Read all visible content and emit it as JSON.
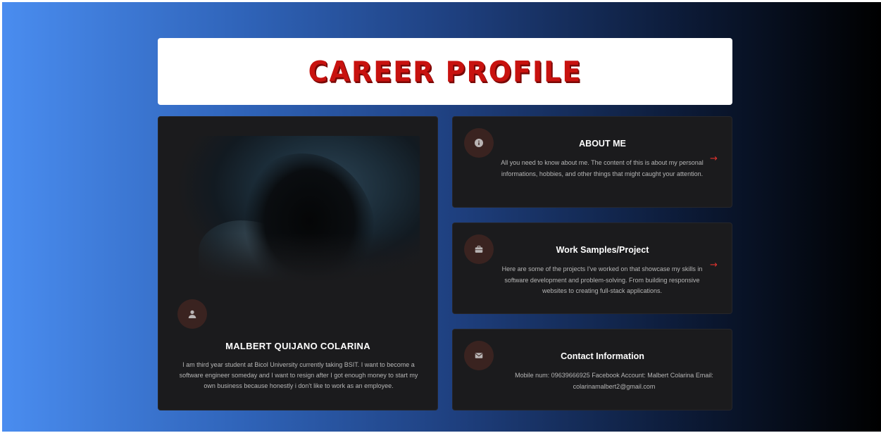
{
  "header": {
    "title": "CAREER PROFILE"
  },
  "profile": {
    "icon": "user-icon",
    "name": "MALBERT QUIJANO COLARINA",
    "description": "I am third year student at Bicol University currently taking BSIT. I want to become a software engineer someday and I want to resign after I got enough money to start my own business because honestly i don't like to work as an employee."
  },
  "cards": {
    "about": {
      "icon": "info-icon",
      "title": "ABOUT ME",
      "description": "All you need to know about me. The content of this is about my personal informations, hobbies, and other things that might caught your attention.",
      "arrow": "→"
    },
    "work": {
      "icon": "briefcase-icon",
      "title": "Work Samples/Project",
      "description": "Here are some of the projects I've worked on that showcase my skills in software development and problem-solving. From building responsive websites to creating full-stack applications.",
      "arrow": "→"
    },
    "contact": {
      "icon": "envelope-icon",
      "title": "Contact Information",
      "description": "Mobile num: 09639666925 Facebook Account: Malbert Colarina Email: colarinamalbert2@gmail.com"
    }
  },
  "colors": {
    "title_red": "#c8120f",
    "card_bg": "#1b1b1d",
    "icon_bg": "#3a2320",
    "arrow_red": "#e0332e"
  }
}
